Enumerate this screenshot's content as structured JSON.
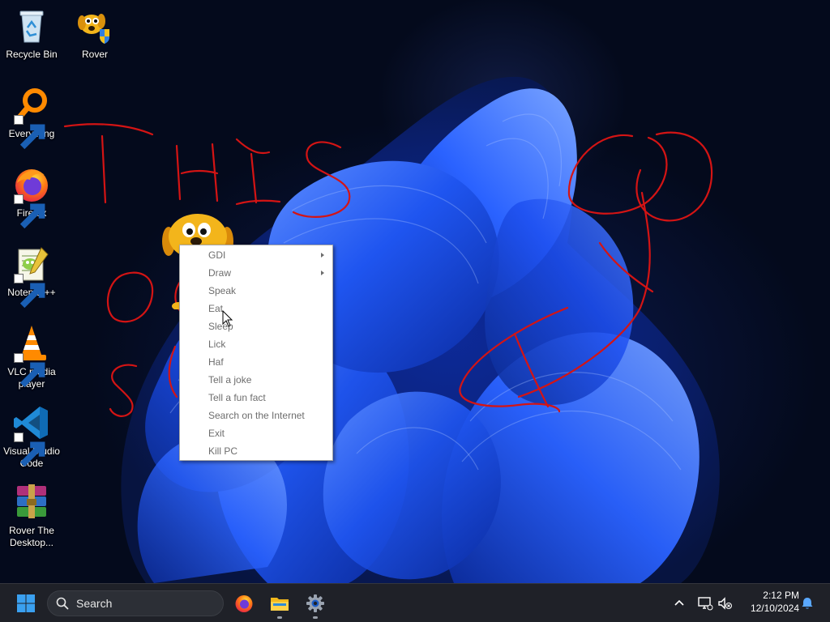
{
  "desktop_icons": [
    {
      "label": "Recycle Bin",
      "icon": "recycle-bin-icon"
    },
    {
      "label": "Rover",
      "icon": "rover-dog-icon"
    },
    {
      "label": "Everything",
      "icon": "everything-search-icon",
      "shortcut": true
    },
    {
      "label": "Firefox",
      "icon": "firefox-icon",
      "shortcut": true
    },
    {
      "label": "Notepad++",
      "icon": "notepad-plus-plus-icon",
      "shortcut": true
    },
    {
      "label": "VLC media player",
      "icon": "vlc-cone-icon",
      "shortcut": true
    },
    {
      "label": "Visual Studio Code",
      "icon": "vscode-icon",
      "shortcut": true
    },
    {
      "label": "Rover The Desktop...",
      "icon": "winrar-archive-icon"
    }
  ],
  "context_menu": {
    "items": [
      {
        "label": "GDI",
        "submenu": true
      },
      {
        "label": "Draw",
        "submenu": true
      },
      {
        "label": "Speak",
        "submenu": false
      },
      {
        "label": "Eat",
        "submenu": false
      },
      {
        "label": "Sleep",
        "submenu": false
      },
      {
        "label": "Lick",
        "submenu": false
      },
      {
        "label": "Haf",
        "submenu": false
      },
      {
        "label": "Tell a joke",
        "submenu": false
      },
      {
        "label": "Tell a fun fact",
        "submenu": false
      },
      {
        "label": "Search on the Internet",
        "submenu": false
      },
      {
        "label": "Exit",
        "submenu": false
      },
      {
        "label": "Kill PC",
        "submenu": false
      }
    ]
  },
  "taskbar": {
    "start": "windows-start-icon",
    "search_label": "Search",
    "pinned": [
      {
        "name": "firefox",
        "icon": "firefox-icon",
        "running": false
      },
      {
        "name": "file-explorer",
        "icon": "folder-icon",
        "running": true
      },
      {
        "name": "settings",
        "icon": "gear-icon",
        "running": true
      }
    ]
  },
  "tray": {
    "time": "2:12 PM",
    "date": "12/10/2024",
    "icons": [
      "chevron-up-icon",
      "network-icon",
      "volume-muted-icon",
      "notification-bell-icon"
    ]
  },
  "colors": {
    "scribble": "#d41414",
    "taskbar_bg": "#1f2128",
    "menu_text": "#6d6d6d",
    "wallpaper_blue": "#1f55f0"
  }
}
